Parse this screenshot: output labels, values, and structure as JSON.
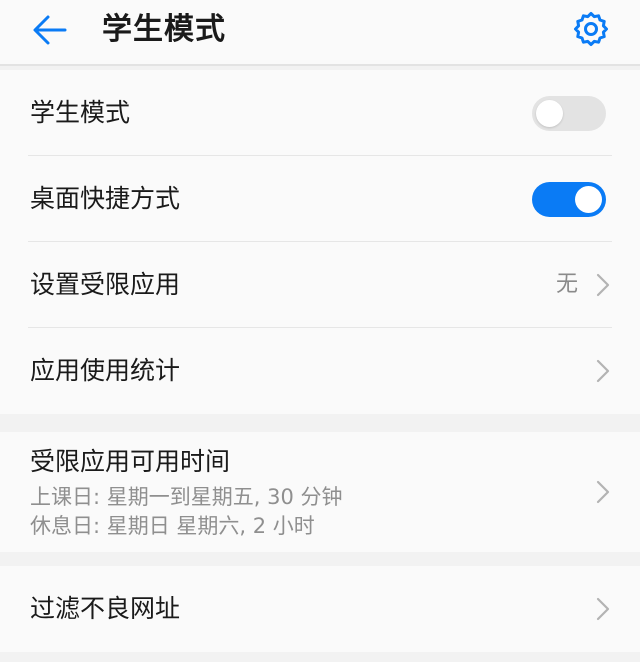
{
  "header": {
    "title": "学生模式",
    "back_icon": "back-arrow-icon",
    "settings_icon": "gear-icon"
  },
  "colors": {
    "accent": "#0a7bf5",
    "toggle_off": "#e3e3e3"
  },
  "group1": {
    "items": [
      {
        "label": "学生模式",
        "control": "toggle",
        "state": "off"
      },
      {
        "label": "桌面快捷方式",
        "control": "toggle",
        "state": "on"
      },
      {
        "label": "设置受限应用",
        "value": "无",
        "control": "chevron"
      },
      {
        "label": "应用使用统计",
        "control": "chevron"
      }
    ]
  },
  "group2": {
    "label": "受限应用可用时间",
    "line1": "上课日: 星期一到星期五, 30 分钟",
    "line2": "休息日: 星期日 星期六, 2 小时"
  },
  "group3": {
    "label": "过滤不良网址"
  }
}
